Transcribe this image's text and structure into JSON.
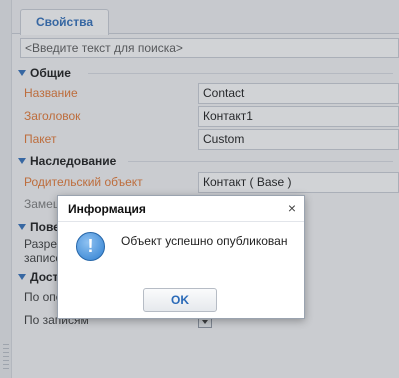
{
  "tabs": {
    "properties": "Свойства"
  },
  "search": {
    "placeholder": "<Введите текст для поиска>"
  },
  "sections": {
    "general": {
      "title": "Общие"
    },
    "inheritance": {
      "title": "Наследование"
    },
    "behavior": {
      "title": "Пове"
    },
    "access": {
      "title": "Дост"
    }
  },
  "general": {
    "name_label": "Название",
    "name_value": "Contact",
    "caption_label": "Заголовок",
    "caption_value": "Контакт1",
    "package_label": "Пакет",
    "package_value": "Custom"
  },
  "inheritance": {
    "parent_label": "Родительский объект",
    "parent_value": "Контакт ( Base )",
    "replace_label": "Замещ"
  },
  "behavior": {
    "line1": "Разре",
    "line2": "записе"
  },
  "access": {
    "by_operations": "По опе",
    "by_records": "По записям"
  },
  "dialog": {
    "title": "Информация",
    "close": "×",
    "icon": "!",
    "message": "Объект успешно опубликован",
    "ok": "OK"
  }
}
